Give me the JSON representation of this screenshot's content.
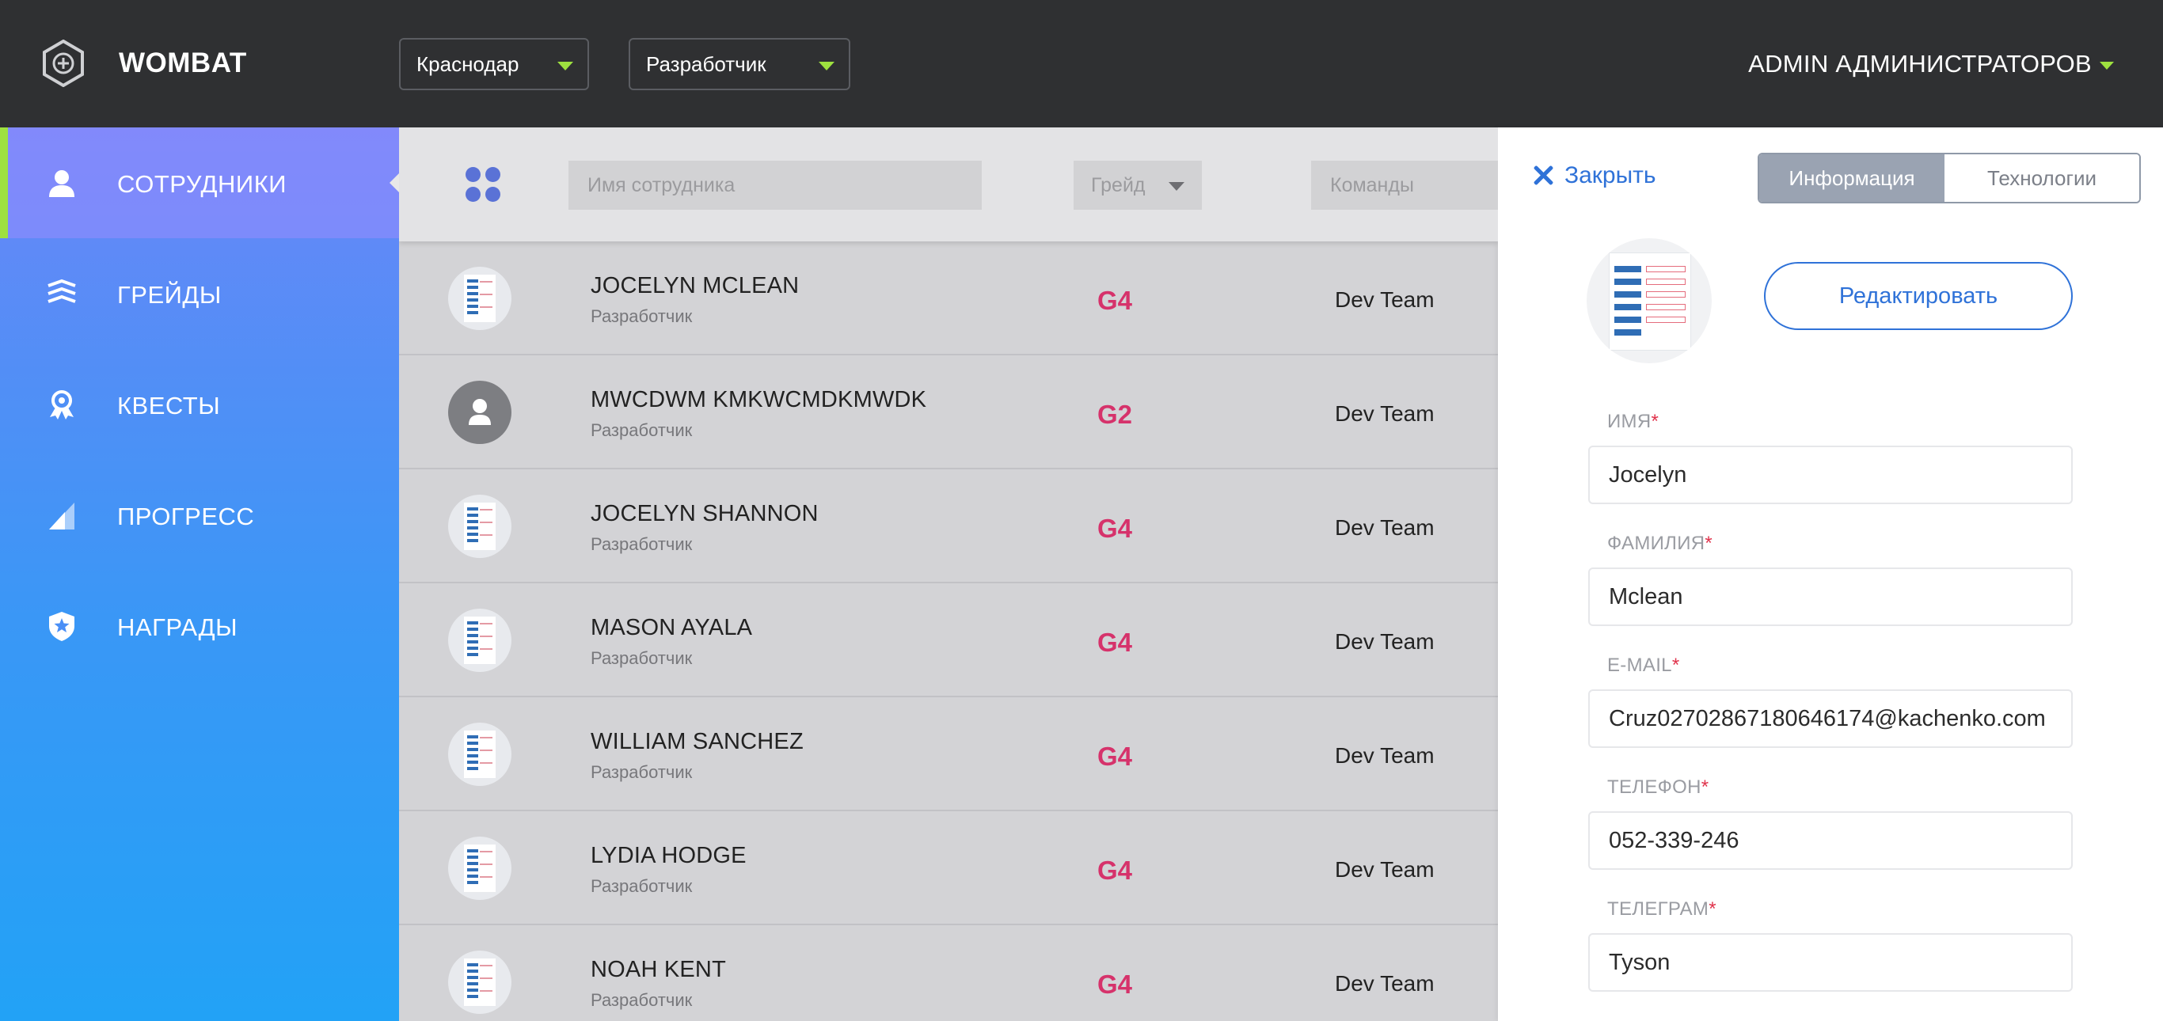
{
  "header": {
    "brand": "WOMBAT",
    "city_select": "Краснодар",
    "role_select": "Разработчик",
    "user_menu": "ADMIN АДМИНИСТРАТОРОВ"
  },
  "sidebar": {
    "items": [
      {
        "label": "СОТРУДНИКИ",
        "icon": "person-icon",
        "active": true
      },
      {
        "label": "ГРЕЙДЫ",
        "icon": "layers-icon",
        "active": false
      },
      {
        "label": "КВЕСТЫ",
        "icon": "medal-icon",
        "active": false
      },
      {
        "label": "ПРОГРЕСС",
        "icon": "signal-icon",
        "active": false
      },
      {
        "label": "НАГРАДЫ",
        "icon": "shield-star-icon",
        "active": false
      }
    ]
  },
  "filters": {
    "name_placeholder": "Имя сотрудника",
    "grade_placeholder": "Грейд",
    "teams_placeholder": "Команды"
  },
  "employees": [
    {
      "name": "JOCELYN MCLEAN",
      "role": "Разработчик",
      "grade": "G4",
      "team": "Dev Team"
    },
    {
      "name": "MWCDWM KMKWCMDKMWDK",
      "role": "Разработчик",
      "grade": "G2",
      "team": "Dev Team"
    },
    {
      "name": "JOCELYN SHANNON",
      "role": "Разработчик",
      "grade": "G4",
      "team": "Dev Team"
    },
    {
      "name": "MASON AYALA",
      "role": "Разработчик",
      "grade": "G4",
      "team": "Dev Team"
    },
    {
      "name": "WILLIAM SANCHEZ",
      "role": "Разработчик",
      "grade": "G4",
      "team": "Dev Team"
    },
    {
      "name": "LYDIA HODGE",
      "role": "Разработчик",
      "grade": "G4",
      "team": "Dev Team"
    },
    {
      "name": "NOAH KENT",
      "role": "Разработчик",
      "grade": "G4",
      "team": "Dev Team"
    }
  ],
  "panel": {
    "close_label": "Закрыть",
    "tab_info": "Информация",
    "tab_tech": "Технологии",
    "edit_label": "Редактировать",
    "required_mark": "*",
    "fields": {
      "first_name": {
        "label": "ИМЯ",
        "value": "Jocelyn"
      },
      "last_name": {
        "label": "ФАМИЛИЯ",
        "value": "Mclean"
      },
      "email": {
        "label": "E-MAIL",
        "value": "Cruz02702867180646174@kachenko.com"
      },
      "phone": {
        "label": "ТЕЛЕФОН",
        "value": "052-339-246"
      },
      "telegram": {
        "label": "ТЕЛЕГРАМ",
        "value": "Tyson"
      }
    }
  },
  "colors": {
    "header_bg": "#2f3032",
    "accent_green": "#9ee13f",
    "grade_pink": "#d6326b",
    "link_blue": "#2f72d8"
  }
}
